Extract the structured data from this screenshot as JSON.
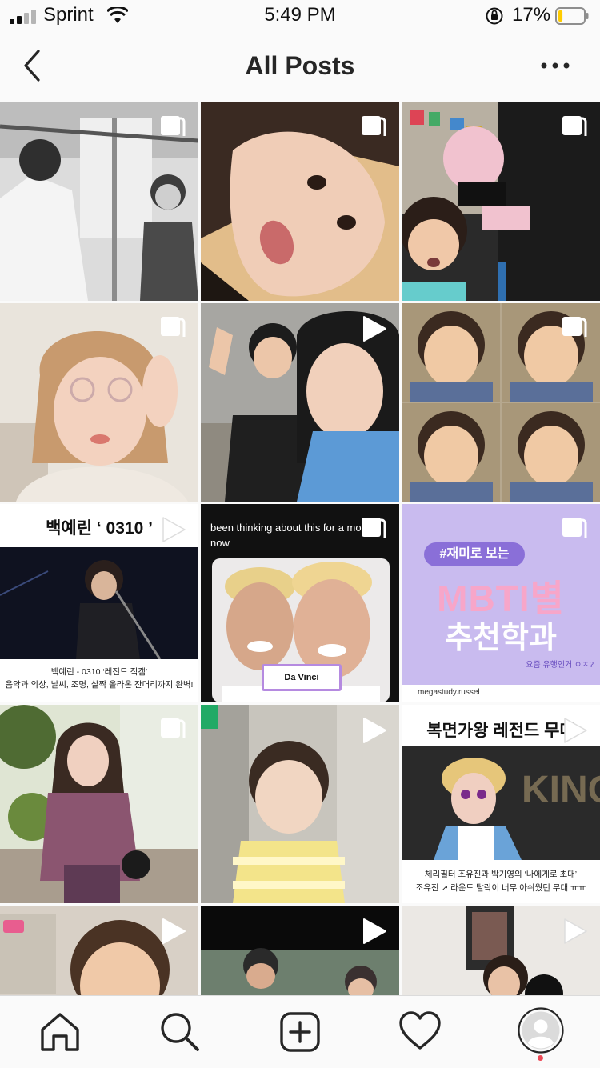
{
  "status_bar": {
    "carrier": "Sprint",
    "time": "5:49 PM",
    "battery_percent": "17%",
    "battery_level": 0.17,
    "battery_color": "#ffcc00"
  },
  "header": {
    "title": "All Posts",
    "back_icon": "chevron-left-icon",
    "more_icon": "ellipsis-icon"
  },
  "posts": [
    {
      "type": "carousel"
    },
    {
      "type": "carousel"
    },
    {
      "type": "carousel"
    },
    {
      "type": "carousel"
    },
    {
      "type": "video"
    },
    {
      "type": "carousel"
    },
    {
      "type": "video",
      "headline": "백예린 ‘ 0310 ’",
      "caption_line1": "백예린 - 0310 ‘레전드 직캠’",
      "caption_line2": "음악과 의상, 날씨, 조명, 살짝 올라온 잔머리까지 완벽!"
    },
    {
      "type": "carousel",
      "overlay_text": "been thinking about this for a mo... now",
      "label": "Da Vinci"
    },
    {
      "type": "carousel",
      "pill": "#재미로 보는",
      "big_line1": "MBTI별",
      "big_line2": "추천학과",
      "small": "요즘 유행인거 ㅇㅈ?",
      "account": "megastudy.russel"
    },
    {
      "type": "carousel"
    },
    {
      "type": "video"
    },
    {
      "type": "video",
      "headline": "복면가왕 레전드 무대",
      "bg_text": "KING OF",
      "caption_line1": "체리필터 조유진과 박기영의 ‘나에게로 초대’",
      "caption_line2": "조유진 ↗ 라운드 탈락이 너무 아쉬웠던 무대 ㅠㅠ"
    },
    {
      "type": "video"
    },
    {
      "type": "video"
    },
    {
      "type": "video"
    }
  ],
  "bottom_nav": [
    {
      "name": "home",
      "icon": "home-icon"
    },
    {
      "name": "search",
      "icon": "search-icon"
    },
    {
      "name": "new-post",
      "icon": "plus-square-icon"
    },
    {
      "name": "activity",
      "icon": "heart-icon"
    },
    {
      "name": "profile",
      "icon": "avatar-icon"
    }
  ],
  "colors": {
    "accent": "#ed4956",
    "lavender": "#c9bbef",
    "purple": "#8a6fd8"
  }
}
